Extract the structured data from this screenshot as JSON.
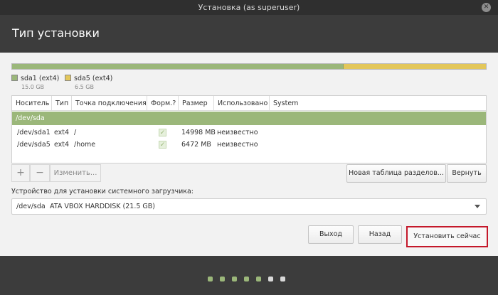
{
  "window": {
    "title": "Установка (as superuser)",
    "close_glyph": "✕"
  },
  "page": {
    "title": "Тип установки"
  },
  "partitions_bar": {
    "segments": [
      {
        "name": "sda1 (ext4)",
        "size": "15.0 GB",
        "color": "#9bb77a",
        "share": 0.699
      },
      {
        "name": "sda5 (ext4)",
        "size": "6.5 GB",
        "color": "#e3c75a",
        "share": 0.301
      }
    ]
  },
  "table": {
    "columns": [
      "Носитель",
      "Тип",
      "Точка подключения",
      "Форм.?",
      "Размер",
      "Использовано",
      "System"
    ],
    "device_row": "/dev/sda",
    "rows": [
      {
        "device": "/dev/sda1",
        "type": "ext4",
        "mount": "/",
        "format": true,
        "size": "14998 MB",
        "used": "неизвестно",
        "system": ""
      },
      {
        "device": "/dev/sda5",
        "type": "ext4",
        "mount": "/home",
        "format": true,
        "size": "6472 MB",
        "used": "неизвестно",
        "system": ""
      }
    ]
  },
  "toolbar": {
    "add_label": "+",
    "remove_label": "−",
    "change_label": "Изменить...",
    "new_table_label": "Новая таблица разделов...",
    "revert_label": "Вернуть"
  },
  "bootloader": {
    "label": "Устройство для установки системного загрузчика:",
    "selected_device": "/dev/sda",
    "selected_disk": "ATA VBOX HARDDISK (21.5 GB)"
  },
  "actions": {
    "quit_label": "Выход",
    "back_label": "Назад",
    "install_label": "Установить сейчас"
  },
  "progress": {
    "steps_total": 7,
    "steps_done": 5,
    "done_color": "#9bb77a",
    "pending_color": "#d9d9d9"
  }
}
